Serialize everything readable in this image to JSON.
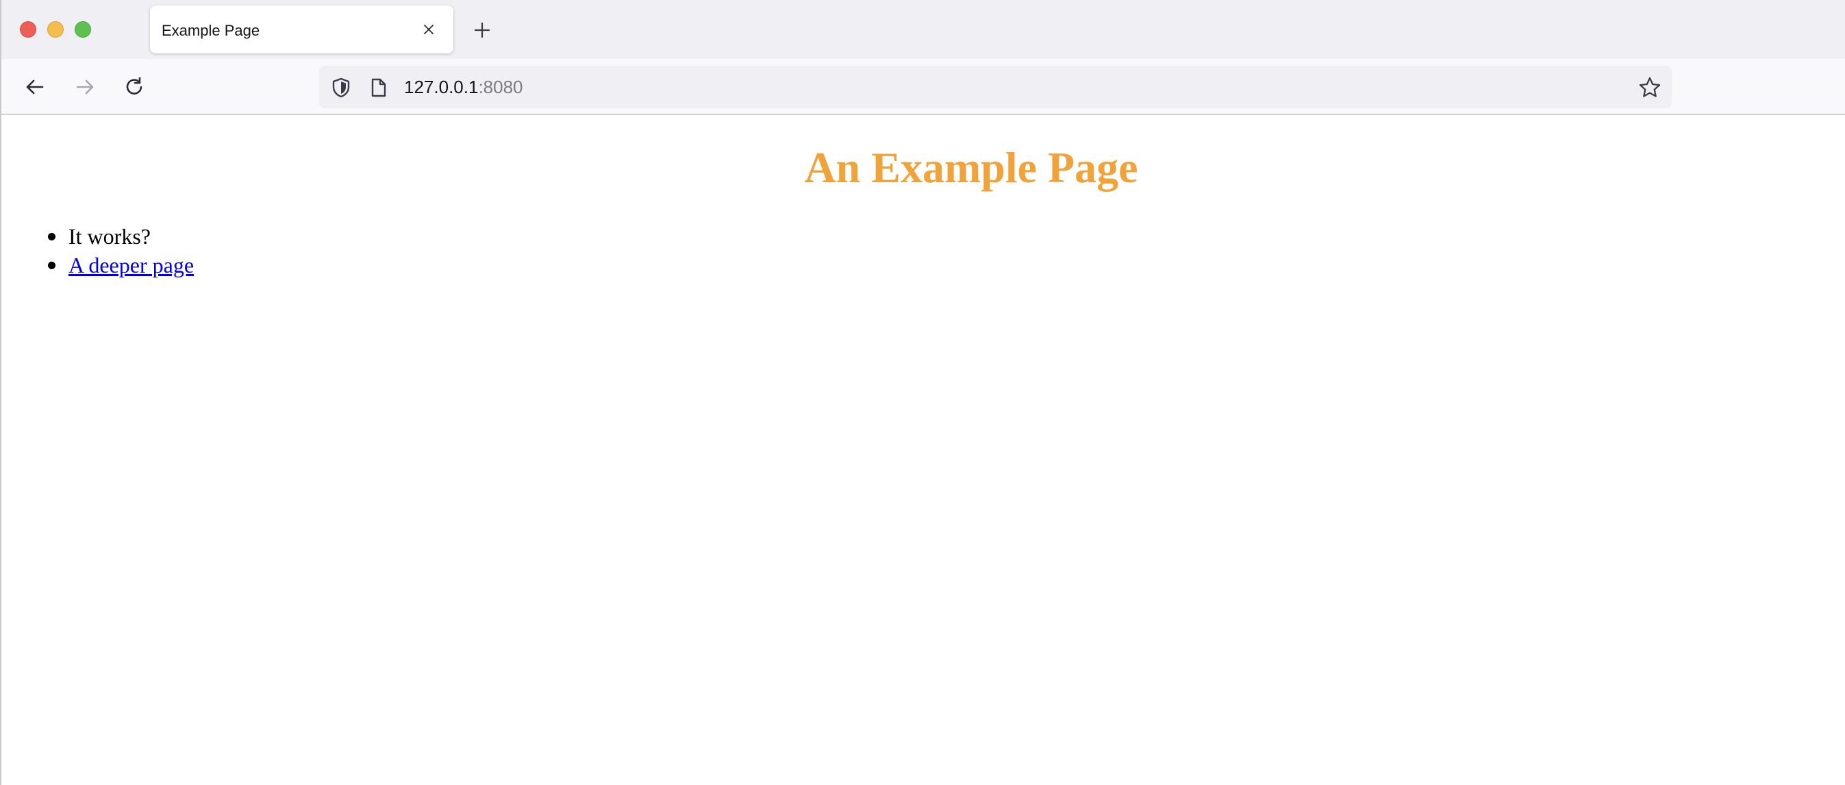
{
  "browser": {
    "tab": {
      "title": "Example Page",
      "close_icon": "close-icon"
    },
    "new_tab_icon": "plus-icon",
    "nav": {
      "back_icon": "arrow-left-icon",
      "forward_icon": "arrow-right-icon",
      "reload_icon": "reload-icon"
    },
    "urlbar": {
      "host": "127.0.0.1",
      "port": ":8080",
      "shield_icon": "shield-icon",
      "page_icon": "page-icon",
      "bookmark_icon": "star-icon"
    }
  },
  "page": {
    "heading": "An Example Page",
    "heading_color": "#f0a33a",
    "list": {
      "item_text": "It works?",
      "link_text": "A deeper page"
    },
    "link_color": "#0000ee"
  }
}
